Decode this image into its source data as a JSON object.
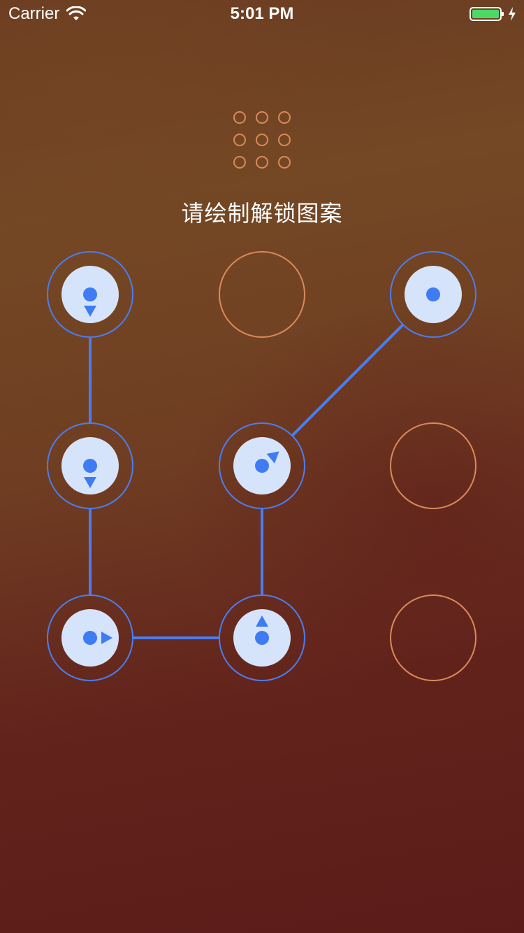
{
  "status_bar": {
    "carrier": "Carrier",
    "time": "5:01 PM",
    "icons": [
      "wifi-icon",
      "battery-icon",
      "charging-bolt-icon"
    ]
  },
  "lock_screen": {
    "prompt": "请绘制解锁图案",
    "preview_grid_rows": 3,
    "preview_grid_cols": 3,
    "nodes": [
      {
        "id": 1,
        "selected": true,
        "direction": "down"
      },
      {
        "id": 2,
        "selected": false,
        "direction": null
      },
      {
        "id": 3,
        "selected": true,
        "direction": null
      },
      {
        "id": 4,
        "selected": true,
        "direction": "down"
      },
      {
        "id": 5,
        "selected": true,
        "direction": "up-right"
      },
      {
        "id": 6,
        "selected": false,
        "direction": null
      },
      {
        "id": 7,
        "selected": true,
        "direction": "right"
      },
      {
        "id": 8,
        "selected": true,
        "direction": "up"
      },
      {
        "id": 9,
        "selected": false,
        "direction": null
      }
    ],
    "pattern_path": [
      1,
      4,
      7,
      8,
      5,
      3
    ]
  },
  "colors": {
    "selected_ring": "#4b7df0",
    "selected_fill": "#d6e4fb",
    "selected_dot": "#3f7bf3",
    "unselected_ring": "#d98a5a",
    "line": "#4b7df0",
    "text": "#ffffff"
  }
}
